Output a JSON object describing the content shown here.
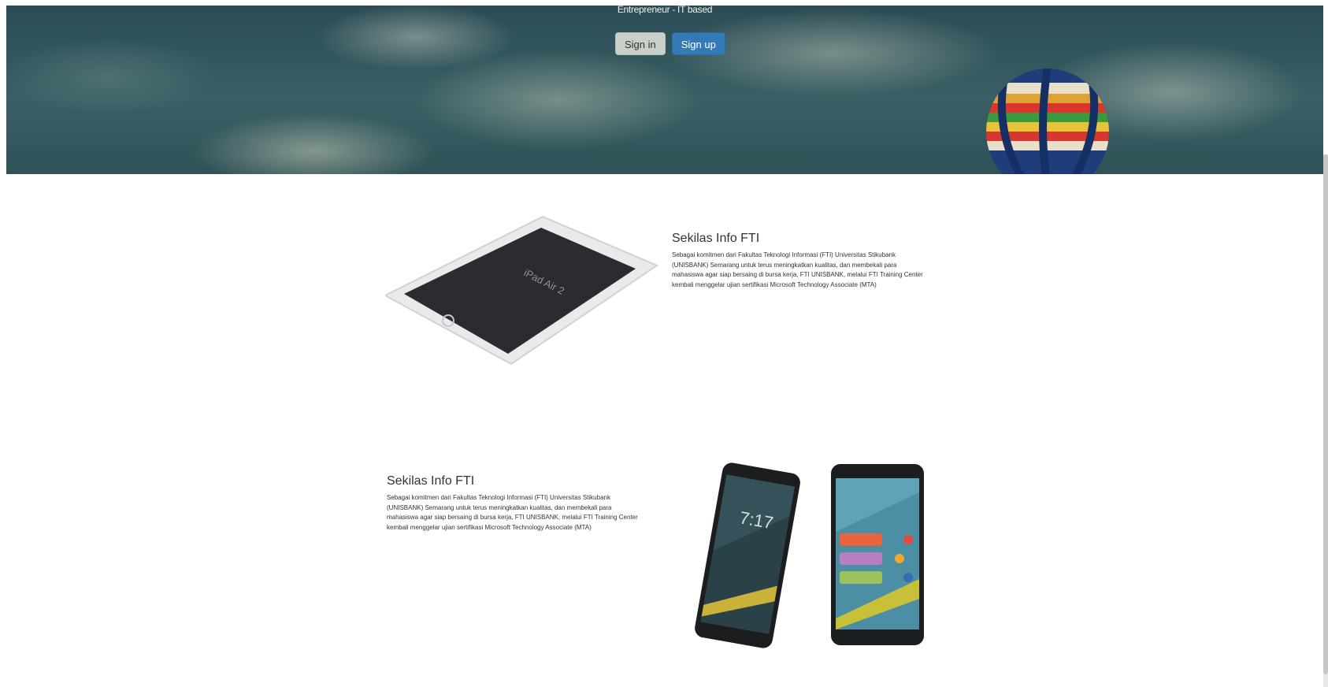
{
  "hero": {
    "subtitle": "Entrepreneur - IT based",
    "signin_label": "Sign in",
    "signup_label": "Sign up"
  },
  "sections": [
    {
      "title": "Sekilas Info FTI",
      "body": "Sebagai komitmen dari Fakultas Teknologi Informasi (FTI) Universitas Stikubank (UNISBANK) Semarang untuk terus meningkatkan kualitas, dan membekali para mahasiswa agar siap bersaing di bursa kerja, FTI UNISBANK, melalui FTI Training Center kembali menggelar ujian sertifikasi Microsoft Technology Associate (MTA)",
      "image": "ipad-air-2-mockup",
      "image_text": "iPad Air 2"
    },
    {
      "title": "Sekilas Info FTI",
      "body": "Sebagai komitmen dari Fakultas Teknologi Informasi (FTI) Universitas Stikubank (UNISBANK) Semarang untuk terus meningkatkan kualitas, dan membekali para mahasiswa agar siap bersaing di bursa kerja, FTI UNISBANK, melalui FTI Training Center kembali menggelar ujian sertifikasi Microsoft Technology Associate (MTA)",
      "image": "android-phones-mockup",
      "image_text": "7:17"
    }
  ],
  "colors": {
    "signup": "#337ab7",
    "signin": "#c9cfc9",
    "hero_sky": "#2b4b55"
  }
}
